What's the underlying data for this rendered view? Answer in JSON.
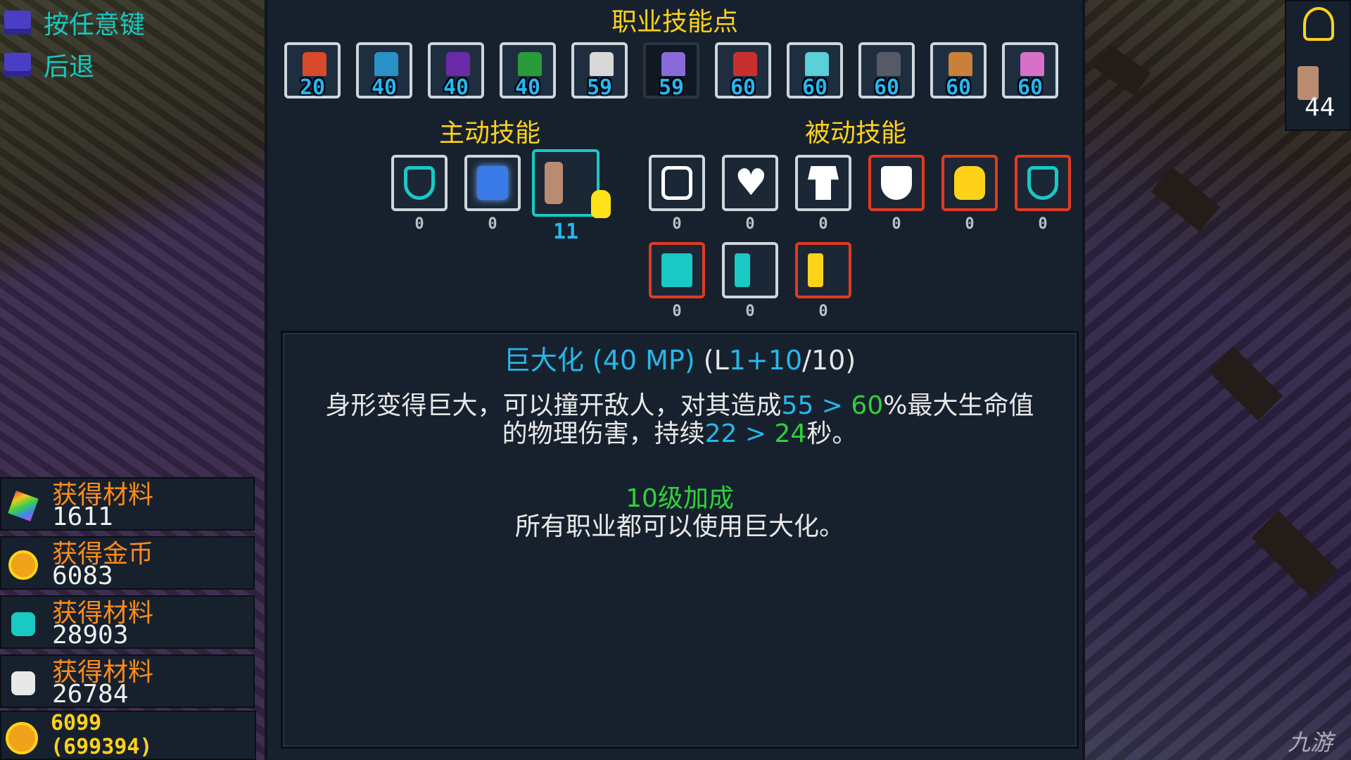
{
  "menu": {
    "any_key_label": "按任意键",
    "back_label": "后退"
  },
  "panel": {
    "title": "职业技能点",
    "active_label": "主动技能",
    "passive_label": "被动技能"
  },
  "classes": [
    {
      "level": "20",
      "color": "#d94a2a"
    },
    {
      "level": "40",
      "color": "#2a90c8"
    },
    {
      "level": "40",
      "color": "#6a2aa8"
    },
    {
      "level": "40",
      "color": "#2a9a3a"
    },
    {
      "level": "59",
      "color": "#d8d8d8"
    },
    {
      "level": "59",
      "color": "#8a6ad8"
    },
    {
      "level": "60",
      "color": "#c83030"
    },
    {
      "level": "60",
      "color": "#5ad0d8"
    },
    {
      "level": "60",
      "color": "#555a66"
    },
    {
      "level": "60",
      "color": "#c8803a"
    },
    {
      "level": "60",
      "color": "#d870c8"
    }
  ],
  "active_skills": [
    {
      "name": "shield-figure",
      "count": "0",
      "color": "#18c9c4"
    },
    {
      "name": "blue-shield",
      "count": "0",
      "color": "#3a7ae8"
    },
    {
      "name": "giant-form",
      "count": "11",
      "color": "#b98c72"
    }
  ],
  "passive_skills": [
    {
      "name": "armor",
      "count": "0",
      "color": "#ffffff"
    },
    {
      "name": "heart",
      "count": "0",
      "color": "#ffffff"
    },
    {
      "name": "body",
      "count": "0",
      "color": "#ffffff"
    },
    {
      "name": "red-shield",
      "count": "0",
      "color": "#ffffff"
    },
    {
      "name": "gold-fist",
      "count": "0",
      "color": "#ffd21a"
    },
    {
      "name": "teal-shield",
      "count": "0",
      "color": "#18c9c4"
    },
    {
      "name": "teal-block",
      "count": "0",
      "color": "#18c9c4"
    },
    {
      "name": "teal-figure",
      "count": "0",
      "color": "#18c9c4"
    },
    {
      "name": "gold-figure",
      "count": "0",
      "color": "#ffd21a"
    }
  ],
  "description": {
    "name_cost": "巨大化 (40 MP)",
    "level_open": " (L",
    "level_cur": "1",
    "level_plus": "+10",
    "level_max": "/10)",
    "line1_a": "身形变得巨大，可以撞开敌人，对其造成",
    "line1_v1": "55",
    "line1_arrow": " > ",
    "line1_v2": "60",
    "line1_b": "%最大生命值",
    "line2_a": "的物理伤害，持续",
    "line2_v1": "22",
    "line2_arrow": " > ",
    "line2_v2": "24",
    "line2_b": "秒。",
    "bonus_title": "10级加成",
    "bonus_text": "所有职业都可以使用巨大化。"
  },
  "resources": [
    {
      "label": "获得材料",
      "value": "1611",
      "icon": "rainbow-material-icon",
      "color": "#d8a0d8"
    },
    {
      "label": "获得金币",
      "value": "6083",
      "icon": "gold-coin-icon",
      "color": "#ffd21a"
    },
    {
      "label": "获得材料",
      "value": "28903",
      "icon": "teal-gem-icon",
      "color": "#18c9c4"
    },
    {
      "label": "获得材料",
      "value": "26784",
      "icon": "white-stone-icon",
      "color": "#e8e8e8"
    }
  ],
  "gold": {
    "current": "6099",
    "total": "(699394)"
  },
  "right_hud": {
    "count": "44"
  },
  "watermark": "九游"
}
